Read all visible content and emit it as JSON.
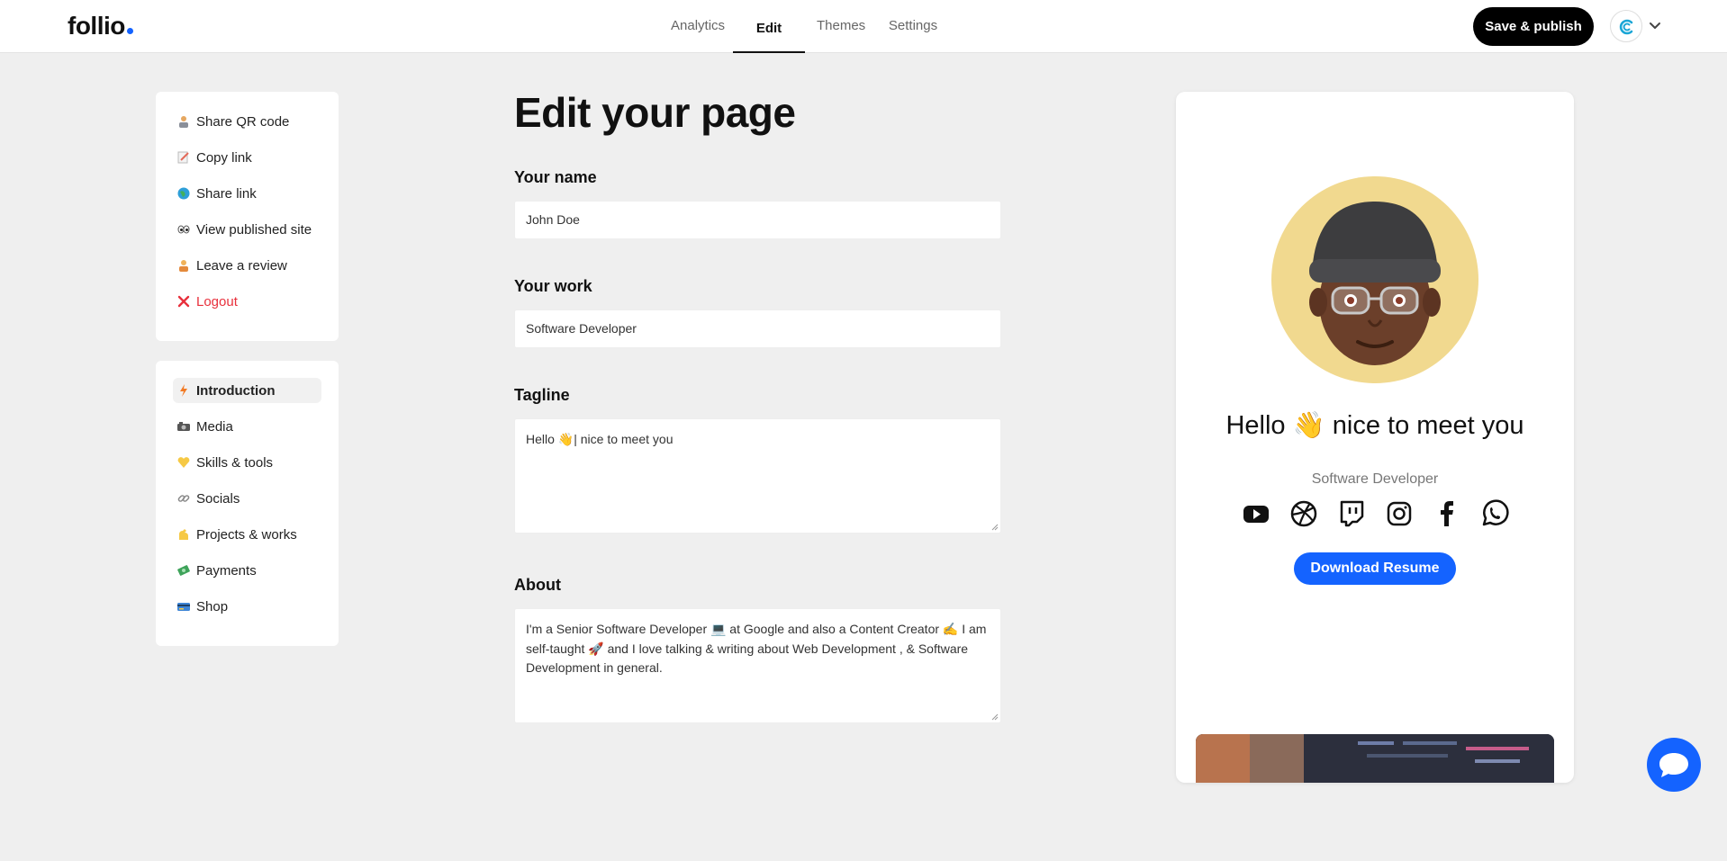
{
  "app": {
    "logo": "follio"
  },
  "nav": {
    "tabs": [
      {
        "label": "Analytics"
      },
      {
        "label": "Edit"
      },
      {
        "label": "Themes"
      },
      {
        "label": "Settings"
      }
    ],
    "active_tab": "Edit",
    "publish_label": "Save & publish"
  },
  "sidebar": {
    "actions": [
      {
        "label": "Share QR code",
        "icon": "person-emoji-icon"
      },
      {
        "label": "Copy link",
        "icon": "memo-icon"
      },
      {
        "label": "Share link",
        "icon": "globe-icon"
      },
      {
        "label": "View published site",
        "icon": "eyes-icon"
      },
      {
        "label": "Leave a review",
        "icon": "person-emoji-icon"
      },
      {
        "label": "Logout",
        "icon": "cross-mark-icon"
      }
    ],
    "sections": [
      {
        "label": "Introduction",
        "icon": "lightning-icon"
      },
      {
        "label": "Media",
        "icon": "camera-icon"
      },
      {
        "label": "Skills & tools",
        "icon": "yellow-heart-icon"
      },
      {
        "label": "Socials",
        "icon": "link-icon"
      },
      {
        "label": "Projects & works",
        "icon": "flexed-arm-icon"
      },
      {
        "label": "Payments",
        "icon": "money-icon"
      },
      {
        "label": "Shop",
        "icon": "credit-card-icon"
      }
    ],
    "active_section": "Introduction"
  },
  "form": {
    "title": "Edit your page",
    "name_label": "Your name",
    "name_value": "John Doe",
    "work_label": "Your work",
    "work_value": "Software Developer",
    "tagline_label": "Tagline",
    "tagline_value": "Hello 👋| nice to meet you",
    "about_label": "About",
    "about_value": "I'm a Senior Software Developer 💻 at Google and also a Content Creator ✍️ I am self-taught 🚀 and I love talking & writing about Web Development , & Software Development in general."
  },
  "preview": {
    "tagline": "Hello 👋 nice to meet you",
    "work": "Software Developer",
    "socials": [
      "youtube-icon",
      "dribbble-icon",
      "twitch-icon",
      "instagram-icon",
      "facebook-icon",
      "whatsapp-icon"
    ],
    "download_label": "Download Resume"
  },
  "colors": {
    "accent": "#1463ff",
    "danger": "#e8303c",
    "avatar_bg": "#f1d98f",
    "background": "#efefef"
  }
}
